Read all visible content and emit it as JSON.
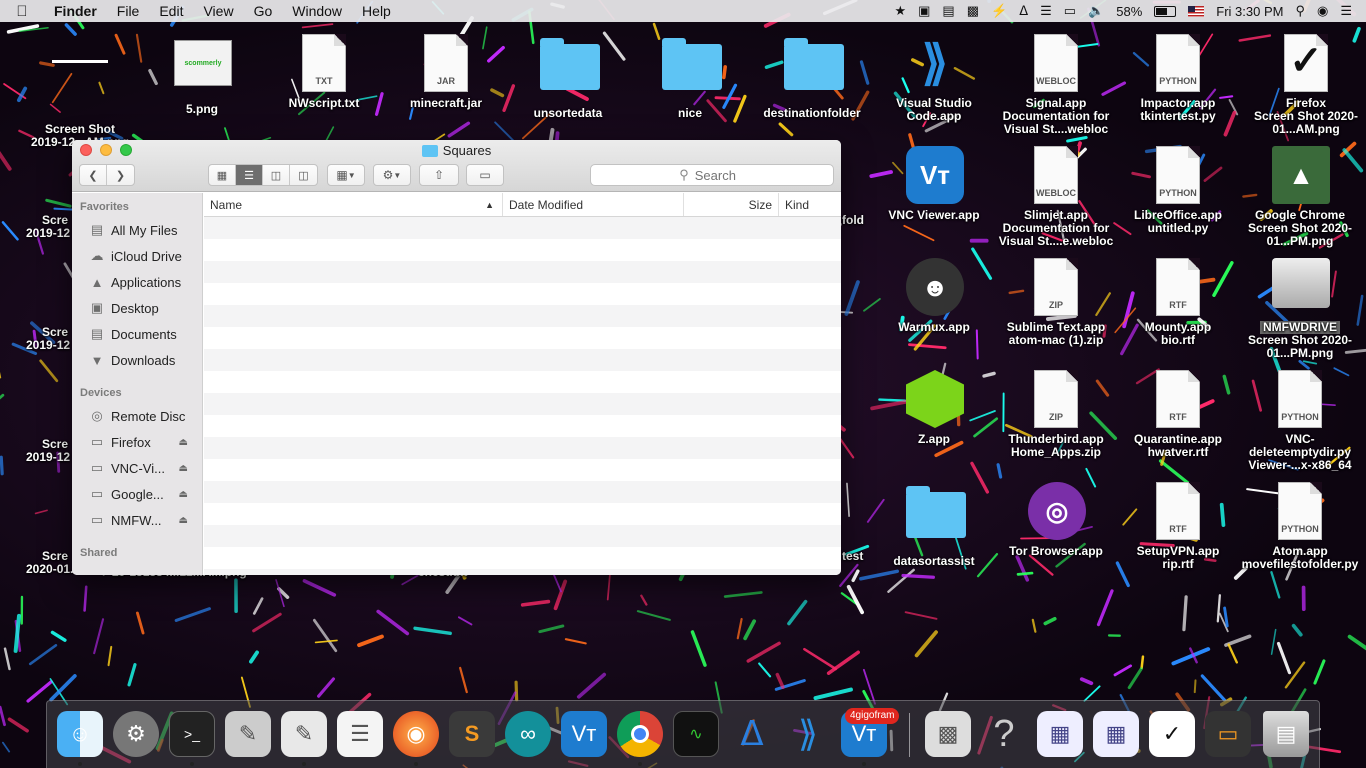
{
  "menubar": {
    "app_name": "Finder",
    "menus": [
      "File",
      "Edit",
      "View",
      "Go",
      "Window",
      "Help"
    ],
    "battery": "58%",
    "clock": "Fri 3:30 PM"
  },
  "desktop": {
    "icons": [
      {
        "label": "Screen Shot",
        "label2": "2019-12...AM.png"
      },
      {
        "label": "5.png",
        "label2": ""
      },
      {
        "label": "NWscript.txt",
        "label2": "",
        "tag": "TXT"
      },
      {
        "label": "minecraft.jar",
        "label2": "",
        "tag": "JAR"
      },
      {
        "label": "unsortedata",
        "label2": ""
      },
      {
        "label": "nice",
        "label2": ""
      },
      {
        "label": "destinationfolder",
        "label2": ""
      },
      {
        "label": "Visual Studio",
        "label2": "Code.app"
      },
      {
        "label": "Signal.app",
        "label2": "Documentation for Visual St....webloc",
        "tag": "WEBLOC"
      },
      {
        "label": "Impactor.app",
        "label2": "tkintertest.py",
        "tag": "PYTHON"
      },
      {
        "label": "Firefox",
        "label2": "Screen Shot 2020-01...AM.png"
      },
      {
        "label": "VNC Viewer.app",
        "label2": ""
      },
      {
        "label": "Slimjet.app",
        "label2": "Documentation for Visual St....e.webloc",
        "tag": "WEBLOC"
      },
      {
        "label": "LibreOffice.app",
        "label2": "untitled.py",
        "tag": "PYTHON"
      },
      {
        "label": "Google Chrome",
        "label2": "Screen Shot 2020-01...PM.png"
      },
      {
        "label": "Warmux.app",
        "label2": ""
      },
      {
        "label": "Sublime Text.app",
        "label2": "atom-mac (1).zip",
        "tag": "ZIP"
      },
      {
        "label": "Mounty.app",
        "label2": "bio.rtf",
        "tag": "RTF"
      },
      {
        "label": "NMFWDRIVE",
        "label2": "Screen Shot 2020-01...PM.png"
      },
      {
        "label": "Z.app",
        "label2": ""
      },
      {
        "label": "Thunderbird.app",
        "label2": "Home_Apps.zip",
        "tag": "ZIP"
      },
      {
        "label": "Quarantine.app",
        "label2": "hwatver.rtf",
        "tag": "RTF"
      },
      {
        "label": "VNC-",
        "label2": "deleteemptydir.py Viewer-...x-x86_64",
        "tag": "PYTHON"
      },
      {
        "label": "datasortassist",
        "label2": ""
      },
      {
        "label": "Tor Browser.app",
        "label2": ""
      },
      {
        "label": "SetupVPN.app",
        "label2": "rip.rtf",
        "tag": "RTF"
      },
      {
        "label": "Atom.app",
        "label2": "movefilestofolder.py",
        "tag": "PYTHON"
      },
      {
        "label": "Scre",
        "label2": "2019-12"
      },
      {
        "label": "Scre",
        "label2": "2019-12"
      },
      {
        "label": "Scre",
        "label2": "2019-12"
      },
      {
        "label": "Scre",
        "label2": "2020-01...AM.png"
      },
      {
        "label": "fold",
        "label2": ""
      },
      {
        "label": "test",
        "label2": ""
      },
      {
        "label": "chest.txt",
        "label2": ""
      },
      {
        "label": "20-151384...12...AM.png",
        "label2": ""
      }
    ],
    "scommerly_label": "scommerly"
  },
  "finder": {
    "title": "Squares",
    "search_placeholder": "Search",
    "sidebar": {
      "favorites_header": "Favorites",
      "favorites": [
        {
          "label": "All My Files",
          "icon": "all-files-icon"
        },
        {
          "label": "iCloud Drive",
          "icon": "cloud-icon"
        },
        {
          "label": "Applications",
          "icon": "applications-icon"
        },
        {
          "label": "Desktop",
          "icon": "desktop-icon"
        },
        {
          "label": "Documents",
          "icon": "documents-icon"
        },
        {
          "label": "Downloads",
          "icon": "downloads-icon"
        }
      ],
      "devices_header": "Devices",
      "devices": [
        {
          "label": "Remote Disc",
          "icon": "disc-icon",
          "eject": false
        },
        {
          "label": "Firefox",
          "icon": "drive-icon",
          "eject": true
        },
        {
          "label": "VNC-Vi...",
          "icon": "drive-icon",
          "eject": true
        },
        {
          "label": "Google...",
          "icon": "drive-icon",
          "eject": true
        },
        {
          "label": "NMFW...",
          "icon": "drive-icon",
          "eject": true
        }
      ],
      "shared_header": "Shared"
    },
    "columns": {
      "name": "Name",
      "date_modified": "Date Modified",
      "size": "Size",
      "kind": "Kind"
    }
  },
  "dock": {
    "badge": "4gigofram",
    "items": [
      "finder-icon",
      "system-preferences-icon",
      "terminal-icon",
      "script-editor-icon",
      "textedit-icon",
      "notes-icon",
      "firefox-icon",
      "sublime-text-icon",
      "arduino-icon",
      "vnc-viewer-icon",
      "chrome-icon",
      "activity-monitor-icon",
      "bluetooth-icon",
      "vscode-icon",
      "vnc-viewer-icon-2",
      "disk-utility-icon",
      "help-icon",
      "screenshot-icon-1",
      "screenshot-icon-2",
      "screenshot-icon-3",
      "screenshot-icon-4",
      "trash-icon"
    ]
  }
}
